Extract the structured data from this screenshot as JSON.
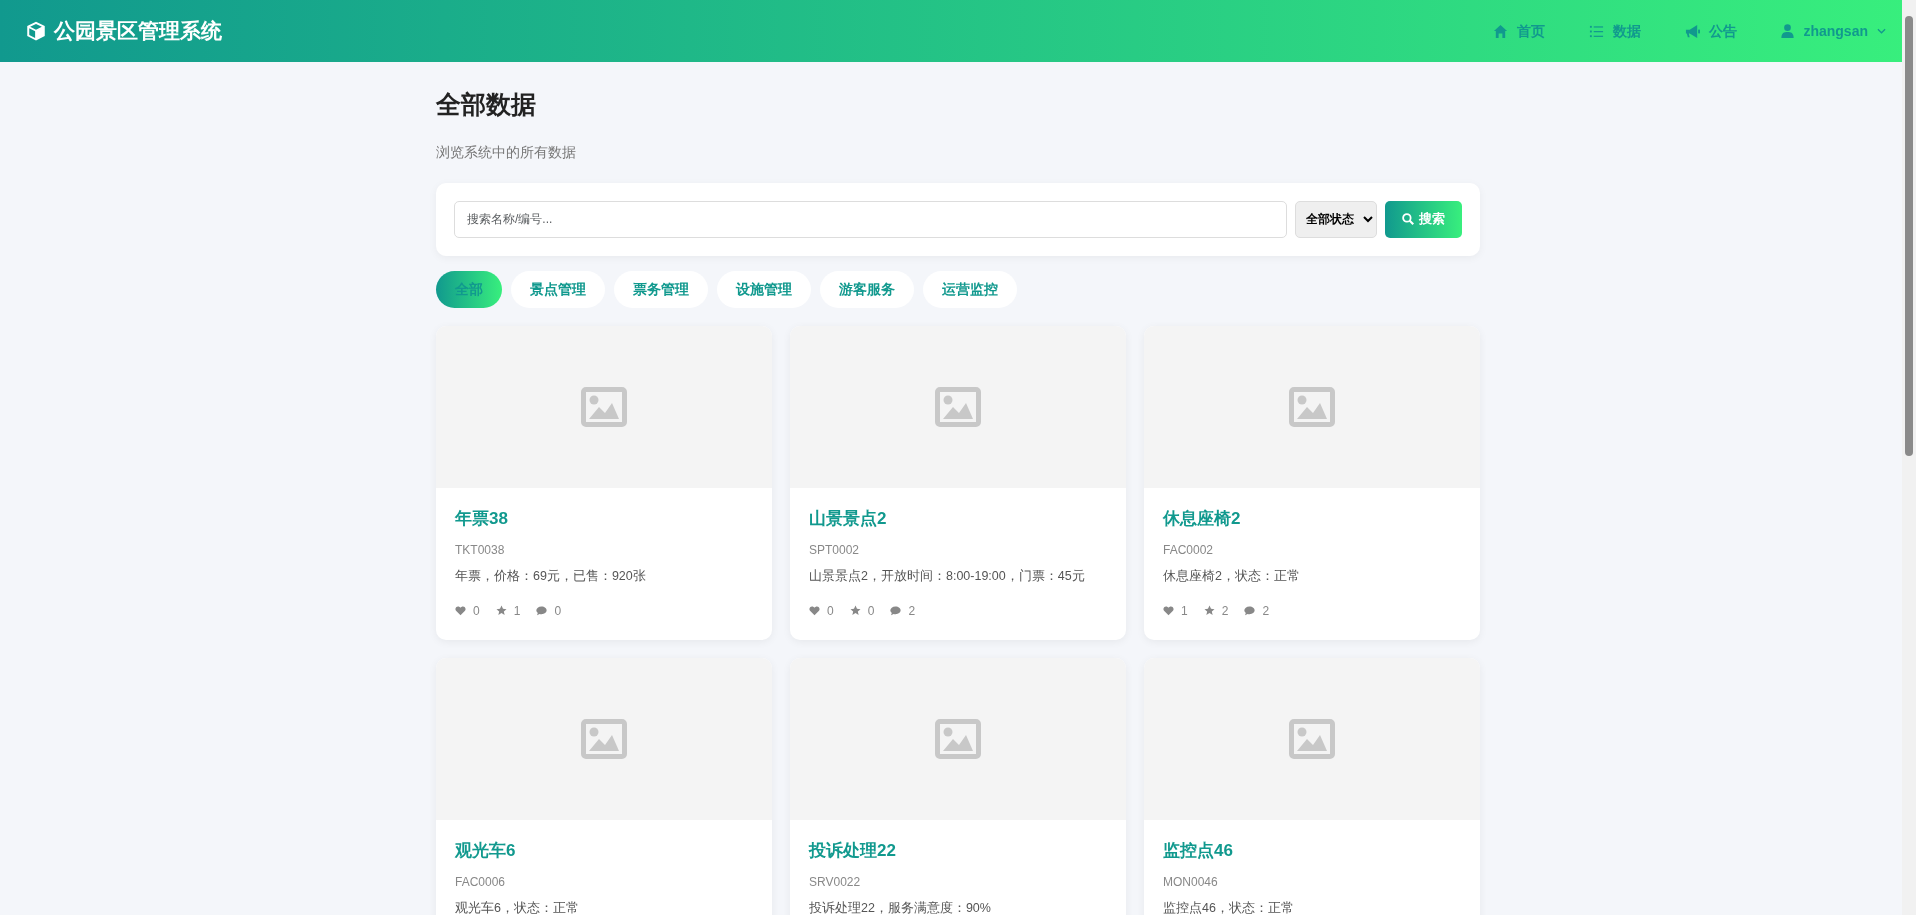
{
  "navbar": {
    "brand": "公园景区管理系统",
    "links": [
      {
        "kind": "home",
        "label": "首页"
      },
      {
        "kind": "list",
        "label": "数据"
      },
      {
        "kind": "megaphone",
        "label": "公告"
      }
    ],
    "user": {
      "name": "zhangsan"
    }
  },
  "page": {
    "title": "全部数据",
    "subtitle": "浏览系统中的所有数据"
  },
  "search": {
    "placeholder": "搜索名称/编号...",
    "status_select": "全部状态",
    "button": "搜索"
  },
  "categories": [
    {
      "label": "全部",
      "selected": true
    },
    {
      "label": "景点管理",
      "selected": false
    },
    {
      "label": "票务管理",
      "selected": false
    },
    {
      "label": "设施管理",
      "selected": false
    },
    {
      "label": "游客服务",
      "selected": false
    },
    {
      "label": "运营监控",
      "selected": false
    }
  ],
  "cards": [
    {
      "title": "年票38",
      "code": "TKT0038",
      "description": "年票，价格：69元，已售：920张",
      "likes": "0",
      "stars": "1",
      "comments": "0"
    },
    {
      "title": "山景景点2",
      "code": "SPT0002",
      "description": "山景景点2，开放时间：8:00-19:00，门票：45元",
      "likes": "0",
      "stars": "0",
      "comments": "2"
    },
    {
      "title": "休息座椅2",
      "code": "FAC0002",
      "description": "休息座椅2，状态：正常",
      "likes": "1",
      "stars": "2",
      "comments": "2"
    },
    {
      "title": "观光车6",
      "code": "FAC0006",
      "description": "观光车6，状态：正常"
    },
    {
      "title": "投诉处理22",
      "code": "SRV0022",
      "description": "投诉处理22，服务满意度：90%"
    },
    {
      "title": "监控点46",
      "code": "MON0046",
      "description": "监控点46，状态：正常"
    }
  ]
}
